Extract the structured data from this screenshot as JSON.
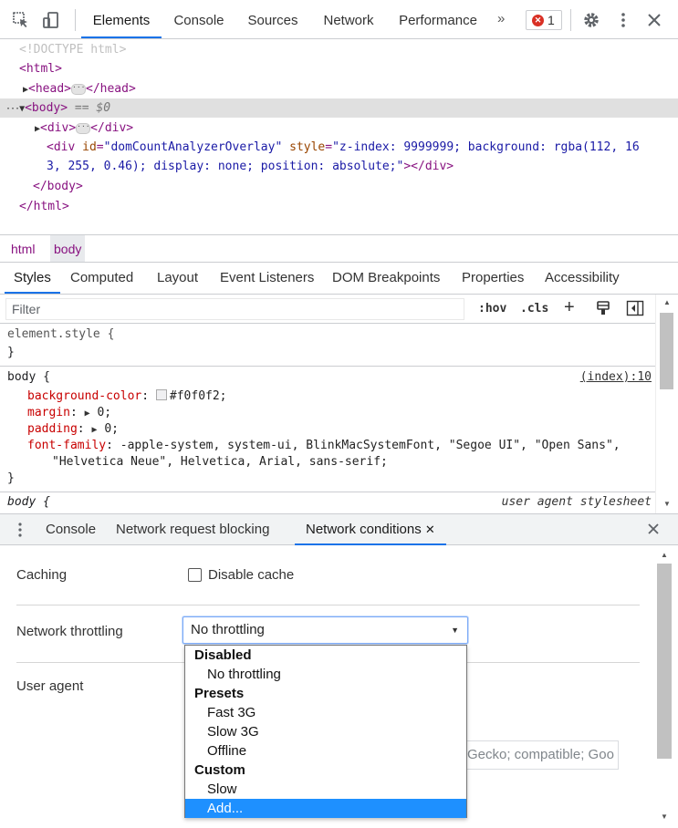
{
  "toolbar": {
    "tabs": [
      "Elements",
      "Console",
      "Sources",
      "Network",
      "Performance"
    ],
    "active_tab": "Elements",
    "overflow": "»",
    "error_count": "1",
    "accent_color": "#1a73e8",
    "error_color": "#d93025"
  },
  "dom": {
    "doctype": "<!DOCTYPE html>",
    "html_open": "<html>",
    "head_open": "<head>",
    "head_close": "</head>",
    "body_open": "<body>",
    "body_marker": "== $0",
    "div_open": "<div>",
    "div_close": "</div>",
    "overlay_tag": "<div",
    "overlay_id_name": "id",
    "overlay_id_value": "\"domCountAnalyzerOverlay\"",
    "overlay_style_name": "style",
    "overlay_style_value_1": "\"z-index: 9999999; background: rgba(112, 16",
    "overlay_style_value_2": "3, 255, 0.46); display: none; position: absolute;\"",
    "overlay_end": "></div>",
    "body_close": "</body>",
    "html_close": "</html>"
  },
  "breadcrumb": [
    "html",
    "body"
  ],
  "styles_tabs": [
    "Styles",
    "Computed",
    "Layout",
    "Event Listeners",
    "DOM Breakpoints",
    "Properties",
    "Accessibility"
  ],
  "filter": {
    "placeholder": "Filter",
    "hov": ":hov",
    "cls": ".cls",
    "plus": "+"
  },
  "rules": {
    "element_style_selector": "element.style {",
    "close_brace": "}",
    "body_selector": "body {",
    "body_source": "(index):10",
    "props": [
      {
        "name": "background-color",
        "value": "#f0f0f2;"
      },
      {
        "name": "margin",
        "value": "0;"
      },
      {
        "name": "padding",
        "value": "0;"
      },
      {
        "name": "font-family",
        "value": "-apple-system, system-ui, BlinkMacSystemFont, \"Segoe UI\", \"Open Sans\","
      }
    ],
    "font_family_cont": "\"Helvetica Neue\", Helvetica, Arial, sans-serif;",
    "ua_selector": "body {",
    "ua_source": "user agent stylesheet"
  },
  "drawer": {
    "tabs": [
      "Console",
      "Network request blocking",
      "Network conditions"
    ],
    "active_tab": "Network conditions",
    "caching_label": "Caching",
    "disable_cache_label": "Disable cache",
    "throttling_label": "Network throttling",
    "throttling_value": "No throttling",
    "user_agent_label": "User agent",
    "user_agent_value": "Gecko; compatible; Goo"
  },
  "dropdown": {
    "groups": [
      {
        "label": "Disabled",
        "items": [
          "No throttling"
        ]
      },
      {
        "label": "Presets",
        "items": [
          "Fast 3G",
          "Slow 3G",
          "Offline"
        ]
      },
      {
        "label": "Custom",
        "items": [
          "Slow",
          "Add..."
        ]
      }
    ],
    "highlighted": "Add...",
    "highlight_color": "#1e90ff"
  }
}
